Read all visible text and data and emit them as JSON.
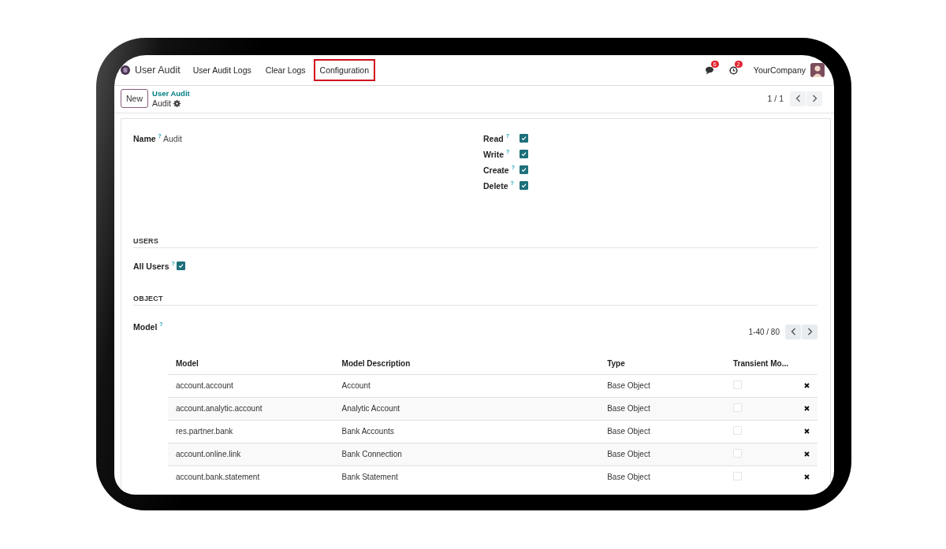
{
  "navbar": {
    "app_name": "User Audit",
    "menu": [
      {
        "label": "User Audit Logs",
        "highlighted": false
      },
      {
        "label": "Clear Logs",
        "highlighted": false
      },
      {
        "label": "Configuration",
        "highlighted": true
      }
    ],
    "messages_badge": "6",
    "activities_badge": "2",
    "company": "YourCompany"
  },
  "control_panel": {
    "new_button": "New",
    "breadcrumb": "User Audit",
    "record_title": "Audit",
    "pager": "1 / 1"
  },
  "form": {
    "name": {
      "label": "Name",
      "help": "?",
      "value": "Audit"
    },
    "permissions": [
      {
        "label": "Read",
        "help": "?",
        "checked": true
      },
      {
        "label": "Write",
        "help": "?",
        "checked": true
      },
      {
        "label": "Create",
        "help": "?",
        "checked": true
      },
      {
        "label": "Delete",
        "help": "?",
        "checked": true
      }
    ],
    "users_section": {
      "title": "USERS",
      "all_users": {
        "label": "All Users",
        "help": "?",
        "checked": true
      }
    },
    "object_section": {
      "title": "OBJECT",
      "model_label": "Model",
      "help": "?",
      "pager": "1-40 / 80",
      "columns": [
        "Model",
        "Model Description",
        "Type",
        "Transient Mo..."
      ],
      "rows": [
        {
          "model": "account.account",
          "description": "Account",
          "type": "Base Object",
          "transient": false
        },
        {
          "model": "account.analytic.account",
          "description": "Analytic Account",
          "type": "Base Object",
          "transient": false
        },
        {
          "model": "res.partner.bank",
          "description": "Bank Accounts",
          "type": "Base Object",
          "transient": false
        },
        {
          "model": "account.online.link",
          "description": "Bank Connection",
          "type": "Base Object",
          "transient": false
        },
        {
          "model": "account.bank.statement",
          "description": "Bank Statement",
          "type": "Base Object",
          "transient": false
        }
      ]
    }
  }
}
